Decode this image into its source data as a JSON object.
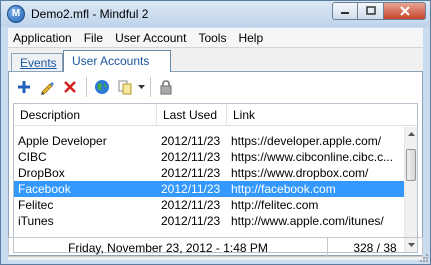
{
  "window": {
    "title": "Demo2.mfl - Mindful 2"
  },
  "menu": [
    "Application",
    "File",
    "User Account",
    "Tools",
    "Help"
  ],
  "tabs": {
    "events": "Events",
    "user_accounts": "User Accounts"
  },
  "columns": [
    "Description",
    "Last Used",
    "Link"
  ],
  "rows": [
    {
      "description": "Apple Developer",
      "last_used": "2012/11/23",
      "link": "https://developer.apple.com/"
    },
    {
      "description": "CIBC",
      "last_used": "2012/11/23",
      "link": "https://www.cibconline.cibc.c..."
    },
    {
      "description": "DropBox",
      "last_used": "2012/11/23",
      "link": "https://www.dropbox.com/"
    },
    {
      "description": "Facebook",
      "last_used": "2012/11/23",
      "link": "http://facebook.com"
    },
    {
      "description": "Felitec",
      "last_used": "2012/11/23",
      "link": "http://felitec.com"
    },
    {
      "description": "iTunes",
      "last_used": "2012/11/23",
      "link": "http://www.apple.com/itunes/"
    }
  ],
  "selected_row": 3,
  "status": {
    "date": "Friday, November 23, 2012 - 1:48 PM",
    "count": "328 / 38"
  },
  "icons": [
    "add-icon",
    "edit-icon",
    "delete-icon",
    "globe-icon",
    "copy-icon",
    "dropdown-arrow-icon",
    "lock-icon"
  ],
  "colors": {
    "selection": "#3399ff",
    "tab_text": "#1a56a0",
    "delete": "#d42020",
    "add": "#1f5fc0"
  }
}
